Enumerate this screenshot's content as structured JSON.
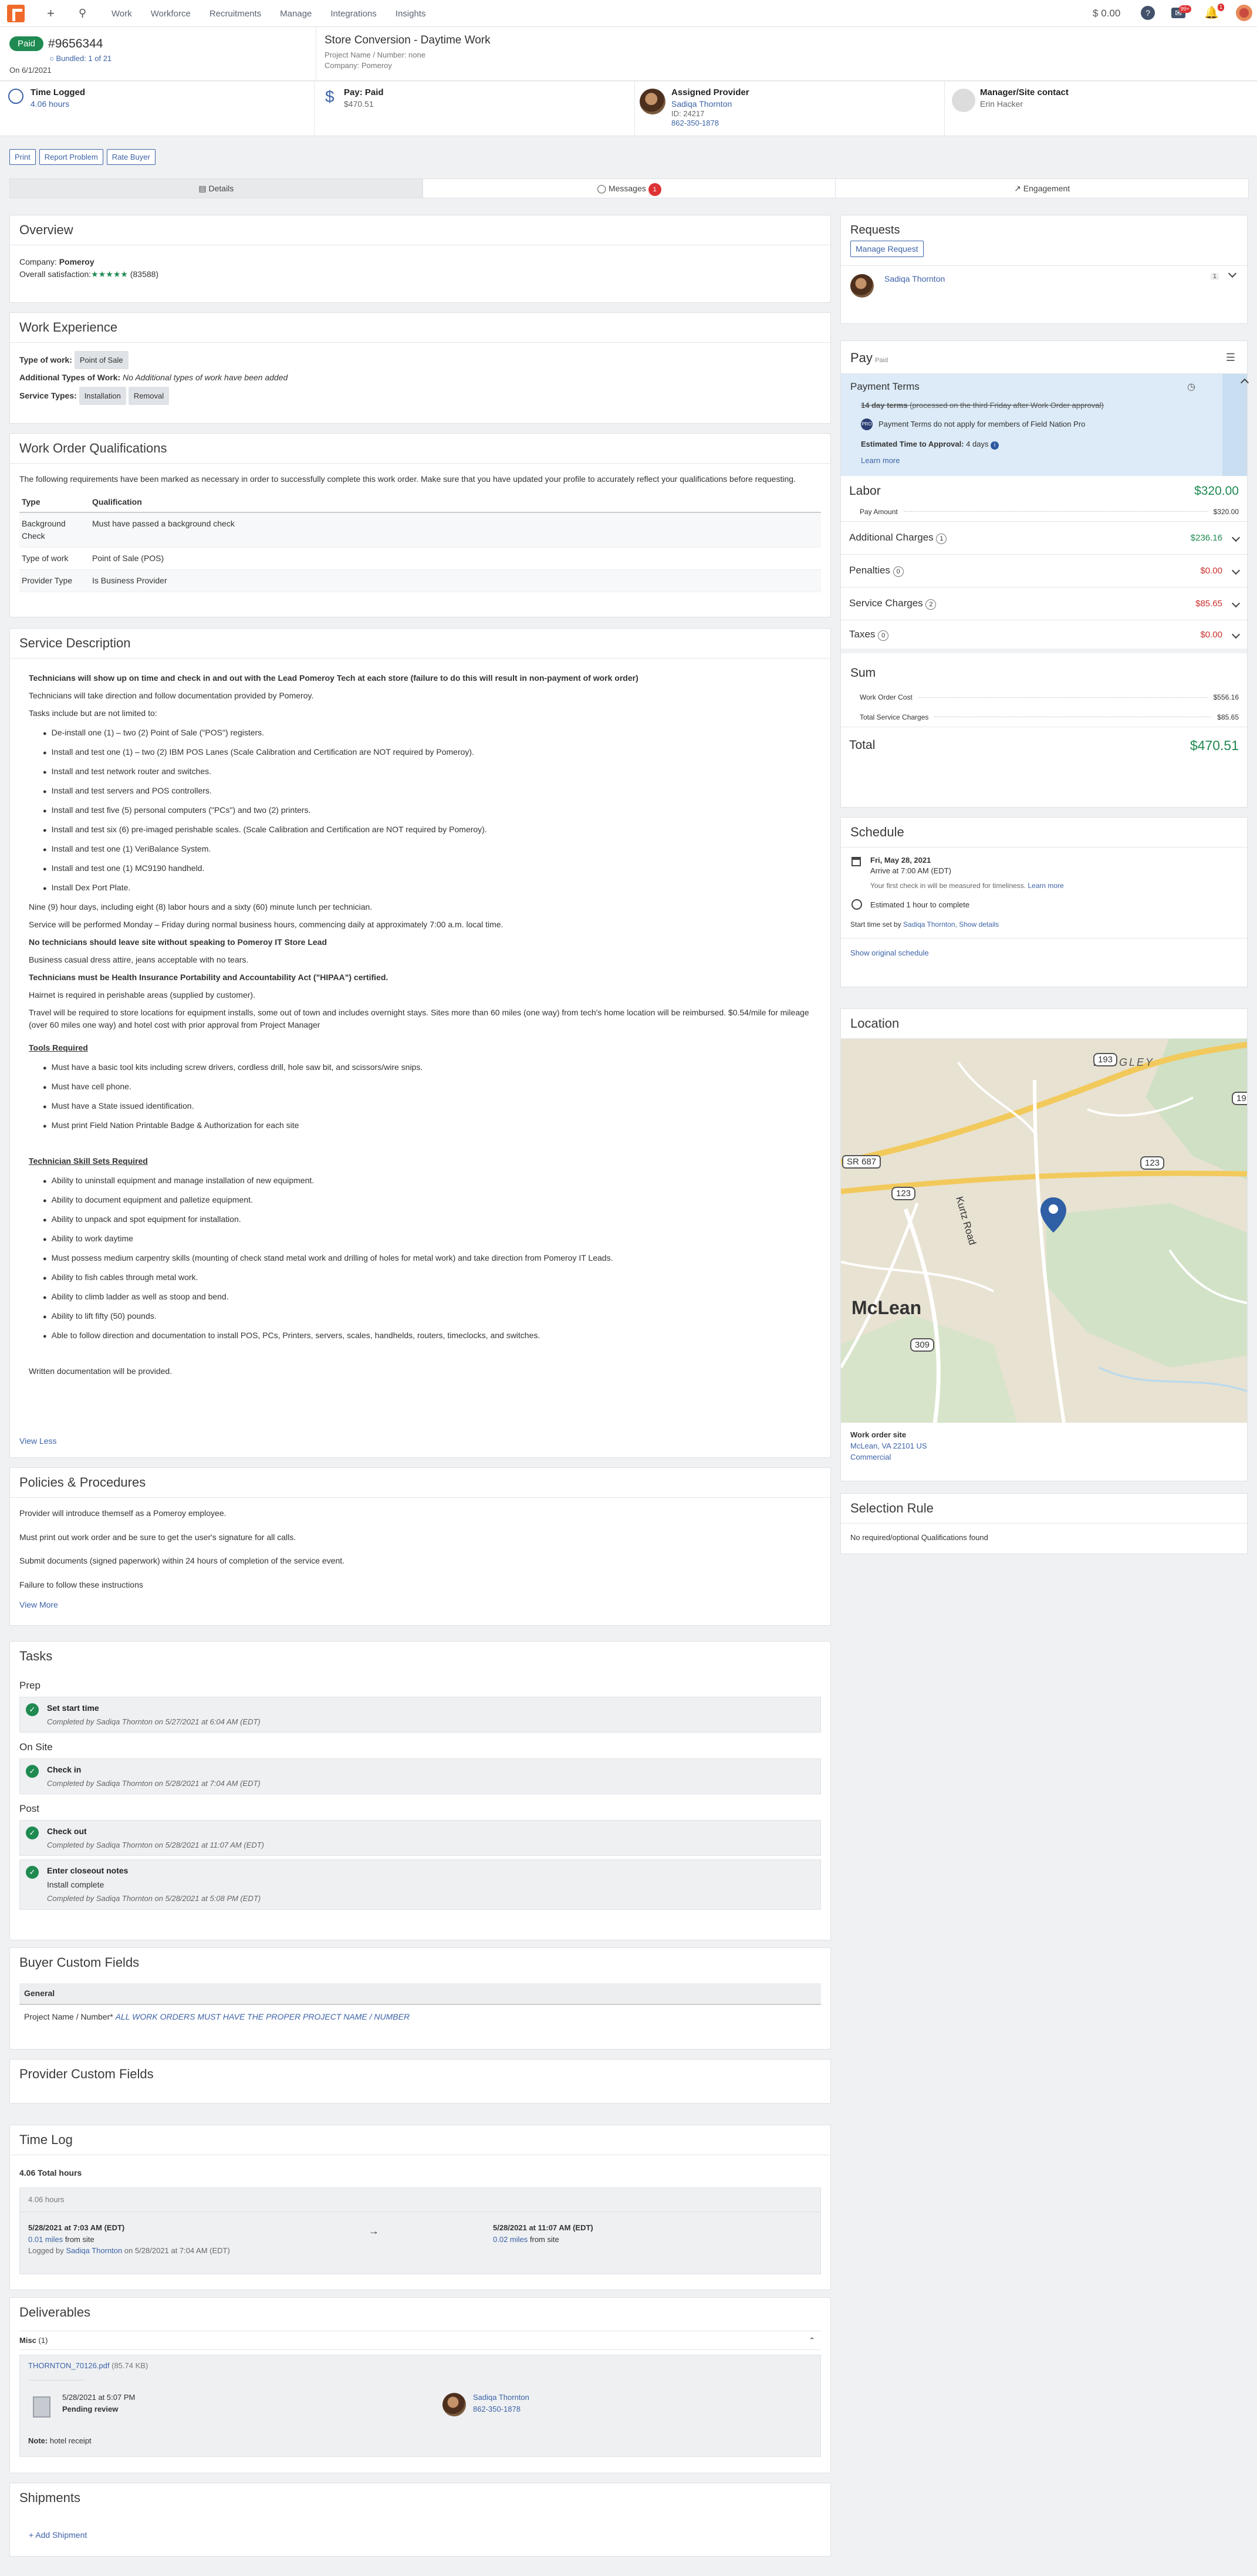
{
  "nav": {
    "links": [
      "Work",
      "Workforce",
      "Recruitments",
      "Manage",
      "Integrations",
      "Insights"
    ],
    "balance": "0.00",
    "help": "?",
    "messages_badge": "99+",
    "notifications_badge": "1"
  },
  "header": {
    "status": "Paid",
    "wo_number": "#9656344",
    "bundled": "Bundled: 1 of 21",
    "date": "On 6/1/2021",
    "title": "Store Conversion - Daytime Work",
    "project": "Project Name / Number: none",
    "company": "Company: Pomeroy"
  },
  "status": {
    "time_label": "Time Logged",
    "time_value": "4.06 hours",
    "pay_label": "Pay: Paid",
    "pay_value": "$470.51",
    "provider_label": "Assigned Provider",
    "provider_name": "Sadiqa Thornton",
    "provider_id": "ID: 24217",
    "provider_phone": "862-350-1878",
    "manager_label": "Manager/Site contact",
    "manager_name": "Erin Hacker"
  },
  "actions": [
    "Print",
    "Report Problem",
    "Rate Buyer"
  ],
  "tabs": {
    "details": "Details",
    "messages": "Messages",
    "messages_count": "1",
    "engagement": "Engagement"
  },
  "overview": {
    "title": "Overview",
    "company_label": "Company:",
    "company": "Pomeroy",
    "satisfaction_label": "Overall satisfaction:",
    "stars": "★★★★★",
    "count": "(83588)"
  },
  "experience": {
    "title": "Work Experience",
    "type_label": "Type of work:",
    "type": "Point of Sale",
    "additional_label": "Additional Types of Work:",
    "additional": "No Additional types of work have been added",
    "service_label": "Service Types:",
    "services": [
      "Installation",
      "Removal"
    ]
  },
  "qualifications": {
    "title": "Work Order Qualifications",
    "intro": "The following requirements have been marked as necessary in order to successfully complete this work order. Make sure that you have updated your profile to accurately reflect your qualifications before requesting.",
    "headers": [
      "Type",
      "Qualification"
    ],
    "rows": [
      [
        "Background Check",
        "Must have passed a background check"
      ],
      [
        "Type of work",
        "Point of Sale (POS)"
      ],
      [
        "Provider Type",
        "Is Business Provider"
      ]
    ]
  },
  "service": {
    "title": "Service Description",
    "p1": "Technicians will show up on time and check in and out with the Lead Pomeroy Tech at each store (failure to do this will result in non-payment of work order)",
    "p2": "Technicians will take direction and follow documentation provided by Pomeroy.",
    "p3": "Tasks include but are not limited to:",
    "tasks": [
      "De-install one (1) – two (2) Point of Sale (\"POS\") registers.",
      "Install and test one (1) – two (2) IBM POS Lanes (Scale Calibration and Certification are NOT required by Pomeroy).",
      "Install and test network router and switches.",
      "Install and test servers and POS controllers.",
      "Install and test five (5) personal computers (\"PCs\") and two (2) printers.",
      "Install and test six (6) pre-imaged perishable scales. (Scale Calibration and Certification are NOT required by Pomeroy).",
      "Install and test one (1) VeriBalance System.",
      "Install and test one (1) MC9190 handheld.",
      "Install Dex Port Plate."
    ],
    "p4": "Nine (9) hour days, including eight (8) labor hours and a sixty (60) minute lunch per technician.",
    "p5": "Service will be performed Monday – Friday during normal business hours, commencing daily at approximately 7:00 a.m. local time.",
    "p6": "No technicians should leave site without speaking to Pomeroy IT Store Lead",
    "p7": "Business casual dress attire, jeans acceptable with no tears.",
    "p8": "Technicians must be Health Insurance Portability and Accountability Act (\"HIPAA\") certified.",
    "p9": "Hairnet is required in perishable areas (supplied by customer).",
    "p10": "Travel will be required to store locations for equipment installs, some out of town and includes overnight stays. Sites more than 60 miles (one way) from tech's home location will be reimbursed. $0.54/mile for mileage (over 60 miles one way) and hotel cost with prior approval from Project Manager",
    "tools_title": "Tools Required",
    "tools": [
      "Must have a basic tool kits including screw drivers, cordless drill, hole saw bit, and scissors/wire snips.",
      "Must have cell phone.",
      "Must have a State issued identification.",
      "Must print Field Nation Printable Badge & Authorization for each site"
    ],
    "skills_title": "Technician Skill Sets Required",
    "skills": [
      "Ability to uninstall equipment and manage installation of new equipment.",
      "Ability to document equipment and palletize equipment.",
      "Ability to unpack and spot equipment for installation.",
      "Ability to work daytime",
      "Must possess medium carpentry skills (mounting of check stand metal work and drilling of holes for metal work) and take direction from Pomeroy IT Leads.",
      "Ability to fish cables through metal work.",
      "Ability to climb ladder as well as stoop and bend.",
      "Ability to lift fifty (50) pounds.",
      "Able to follow direction and documentation to install POS, PCs, Printers, servers, scales, handhelds, routers, timeclocks, and switches."
    ],
    "p11": "Written documentation will be provided.",
    "view_less": "View Less"
  },
  "policies": {
    "title": "Policies & Procedures",
    "lines": [
      "Provider will introduce themself as a Pomeroy employee.",
      "Must print out work order and be sure to get the user's signature for all calls.",
      "Submit documents (signed paperwork) within 24 hours of completion of the service event.",
      "Failure to follow these instructions"
    ],
    "view_more": "View More"
  },
  "tasks": {
    "title": "Tasks",
    "phases": [
      {
        "name": "Prep",
        "items": [
          {
            "title": "Set start time",
            "by": "Completed by Sadiqa Thornton on 5/27/2021 at 6:04 AM (EDT)"
          }
        ]
      },
      {
        "name": "On Site",
        "items": [
          {
            "title": "Check in",
            "by": "Completed by Sadiqa Thornton on 5/28/2021 at 7:04 AM (EDT)"
          }
        ]
      },
      {
        "name": "Post",
        "items": [
          {
            "title": "Check out",
            "by": "Completed by Sadiqa Thornton on 5/28/2021 at 11:07 AM (EDT)"
          },
          {
            "title": "Enter closeout notes",
            "note": "Install complete",
            "by": "Completed by Sadiqa Thornton on 5/28/2021 at 5:08 PM (EDT)"
          }
        ]
      }
    ]
  },
  "buyer_fields": {
    "title": "Buyer Custom Fields",
    "group": "General",
    "label": "Project Name / Number*",
    "value": "ALL WORK ORDERS MUST HAVE THE PROPER PROJECT NAME / NUMBER"
  },
  "provider_fields": {
    "title": "Provider Custom Fields"
  },
  "timelog": {
    "title": "Time Log",
    "total": "4.06 Total hours",
    "hours": "4.06 hours",
    "in_time": "5/28/2021 at 7:03 AM (EDT)",
    "in_dist": "0.01 miles",
    "in_from": "from site",
    "logged_prefix": "Logged by",
    "logged_name": "Sadiqa Thornton",
    "logged_suffix": "on 5/28/2021 at 7:04 AM (EDT)",
    "out_time": "5/28/2021 at 11:07 AM (EDT)",
    "out_dist": "0.02 miles",
    "out_from": "from site"
  },
  "deliverables": {
    "title": "Deliverables",
    "group": "Misc",
    "group_count": "(1)",
    "file": "THORNTON_70126.pdf",
    "size": "(85.74 KB)",
    "uploaded": "5/28/2021 at 5:07 PM",
    "review": "Pending review",
    "uploader": "Sadiqa Thornton",
    "uploader_phone": "862-350-1878",
    "note_label": "Note:",
    "note": "hotel receipt"
  },
  "shipments": {
    "title": "Shipments",
    "add": "Add Shipment"
  },
  "requests": {
    "title": "Requests",
    "manage": "Manage Request",
    "name": "Sadiqa Thornton",
    "count": "1"
  },
  "pay": {
    "title": "Pay",
    "status": "Paid",
    "terms_title": "Payment Terms",
    "terms_strike": "14 day terms",
    "terms_strike_rest": "(processed on the third Friday after Work Order approval)",
    "pro_note": "Payment Terms do not apply for members of Field Nation Pro",
    "est_label": "Estimated Time to Approval:",
    "est": "4 days",
    "learn": "Learn more",
    "labor": "Labor",
    "labor_value": "$320.00",
    "pay_amount": "Pay Amount",
    "pay_amount_value": "$320.00",
    "additional": "Additional Charges",
    "additional_count": "1",
    "additional_value": "$236.16",
    "penalties": "Penalties",
    "penalties_count": "0",
    "penalties_value": "$0.00",
    "service_charges": "Service Charges",
    "service_count": "2",
    "service_value": "$85.65",
    "taxes": "Taxes",
    "taxes_count": "0",
    "taxes_value": "$0.00",
    "sum": "Sum",
    "wo_cost": "Work Order Cost",
    "wo_cost_value": "$556.16",
    "total_service": "Total Service Charges",
    "total_service_value": "$85.65",
    "total": "Total",
    "total_value": "$470.51",
    "colors": {
      "green": "#1f8a51",
      "red": "#c9302c"
    }
  },
  "schedule": {
    "title": "Schedule",
    "date": "Fri, May 28, 2021",
    "arrive": "Arrive at 7:00 AM (EDT)",
    "timeliness": "Your first check in will be measured for timeliness.",
    "learn": "Learn more",
    "estimate": "Estimated 1 hour to complete",
    "set_by_prefix": "Start time set by",
    "set_by": "Sadiqa Thornton",
    "show": "Show details",
    "original": "Show original schedule"
  },
  "location": {
    "title": "Location",
    "map": {
      "town": "McLean",
      "area": "LANGLEY",
      "road": "Kurtz Road",
      "shields": [
        "193",
        "123",
        "123",
        "SR 687",
        "309",
        "19"
      ]
    },
    "site_label": "Work order site",
    "address": "McLean, VA 22101 US",
    "type": "Commercial"
  },
  "selection": {
    "title": "Selection Rule",
    "text": "No required/optional Qualifications found"
  }
}
